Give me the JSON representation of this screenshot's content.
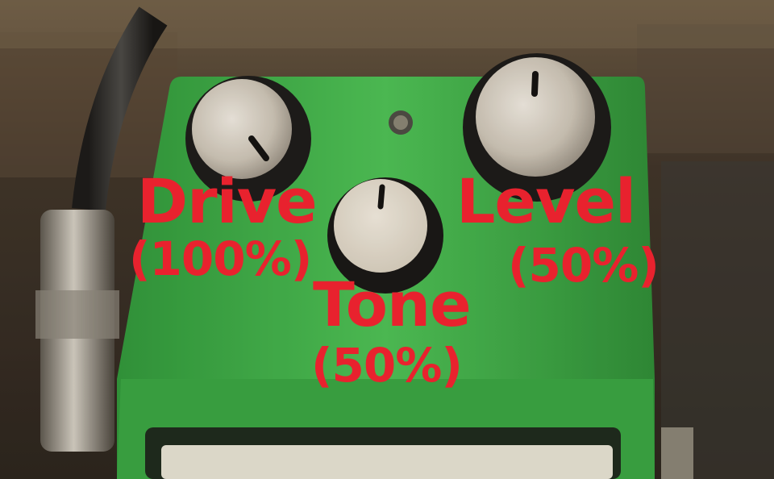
{
  "overlay": {
    "drive": {
      "name": "Drive",
      "value": "(100%)"
    },
    "tone": {
      "name": "Tone",
      "value": "(50%)"
    },
    "level": {
      "name": "Level",
      "value": "(50%)"
    }
  },
  "knobs": {
    "drive": {
      "setting_fraction": 1.0
    },
    "tone": {
      "setting_fraction": 0.5
    },
    "level": {
      "setting_fraction": 0.5
    }
  },
  "colors": {
    "label": "#e8222e",
    "pedal_green": "#3fb54a",
    "background": "#3a3128"
  }
}
